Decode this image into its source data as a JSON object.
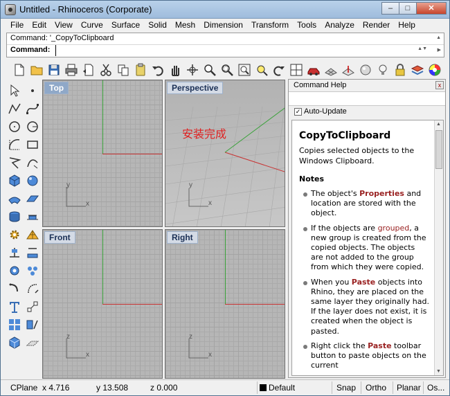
{
  "window": {
    "title": "Untitled - Rhinoceros (Corporate)",
    "controls": {
      "minimize": "–",
      "maximize": "□",
      "close": "✕"
    }
  },
  "menu": [
    "File",
    "Edit",
    "View",
    "Curve",
    "Surface",
    "Solid",
    "Mesh",
    "Dimension",
    "Transform",
    "Tools",
    "Analyze",
    "Render",
    "Help"
  ],
  "command": {
    "history": "Command: '_CopyToClipboard",
    "prompt": "Command:",
    "input_value": ""
  },
  "toolbar_icons": [
    "new-file-icon",
    "open-folder-icon",
    "save-icon",
    "print-icon",
    "import-icon",
    "cut-icon",
    "copy-icon",
    "paste-icon",
    "undo-icon",
    "pan-hand-icon",
    "rotate-view-icon",
    "zoom-icon",
    "zoom-window-icon",
    "zoom-extents-icon",
    "zoom-selected-icon",
    "redo-view-icon",
    "four-viewports-icon",
    "car-icon",
    "grid-plane-icon",
    "cplane-icon",
    "sphere-icon",
    "light-bulb-icon",
    "lock-icon",
    "layer-icon",
    "color-wheel-icon"
  ],
  "left_tool_icons": [
    "select-arrow-icon",
    "point-icon",
    "polyline-icon",
    "curve-icon",
    "circle-icon",
    "circle-center-icon",
    "arc-icon",
    "rectangle-icon",
    "freeform-icon",
    "curve-edit-icon",
    "box-icon",
    "sphere-icon",
    "surface-icon",
    "plane-surface-icon",
    "extrude-icon",
    "cylinder-icon",
    "gear-icon",
    "mesh-icon",
    "bend-icon",
    "boolean-icon",
    "dimension-icon",
    "array-icon",
    "fillet-icon",
    "transform-icon",
    "text-icon",
    "align-icon",
    "group-icon",
    "analyze-icon",
    "solid-box-icon",
    "grid-toggle-icon"
  ],
  "viewports": {
    "top": {
      "label": "Top",
      "gizmo_x": "x",
      "gizmo_y": "y"
    },
    "perspective": {
      "label": "Perspective",
      "gizmo_x": "x",
      "gizmo_y": "y",
      "overlay_text": "安装完成"
    },
    "front": {
      "label": "Front",
      "gizmo_x": "x",
      "gizmo_y": "z"
    },
    "right": {
      "label": "Right",
      "gizmo_x": "x",
      "gizmo_y": "z"
    }
  },
  "help_panel": {
    "title": "Command Help",
    "close_glyph": "x",
    "auto_update_label": "Auto-Update",
    "auto_update_checked": "✓",
    "command_name": "CopyToClipboard",
    "description": "Copies selected objects to the Windows Clipboard.",
    "notes_heading": "Notes",
    "notes": [
      {
        "pre": "The object's ",
        "kw": "Properties",
        "post": " and location are stored with the object."
      },
      {
        "pre": "If the objects are ",
        "kw": "grouped",
        "post": ", a new group is created from the copied objects. The objects are not added to the group from which they were copied."
      },
      {
        "pre": "When you ",
        "kw": "Paste",
        "post": " objects into Rhino, they are placed on the same layer they originally had. If the layer does not exist, it is created when the object is pasted."
      },
      {
        "pre": "Right click the ",
        "kw": "Paste",
        "post": " toolbar button to paste objects on the current"
      }
    ]
  },
  "status": {
    "cplane": "CPlane",
    "x": "x 4.716",
    "y": "y 13.508",
    "z": "z 0.000",
    "layer": "Default",
    "layer_color": "#000000",
    "snap": "Snap",
    "ortho": "Ortho",
    "planar": "Planar",
    "osnap": "Os..."
  },
  "colors": {
    "x_axis": "#c83232",
    "y_axis": "#3aa23a",
    "keyword": "#9a2222"
  }
}
